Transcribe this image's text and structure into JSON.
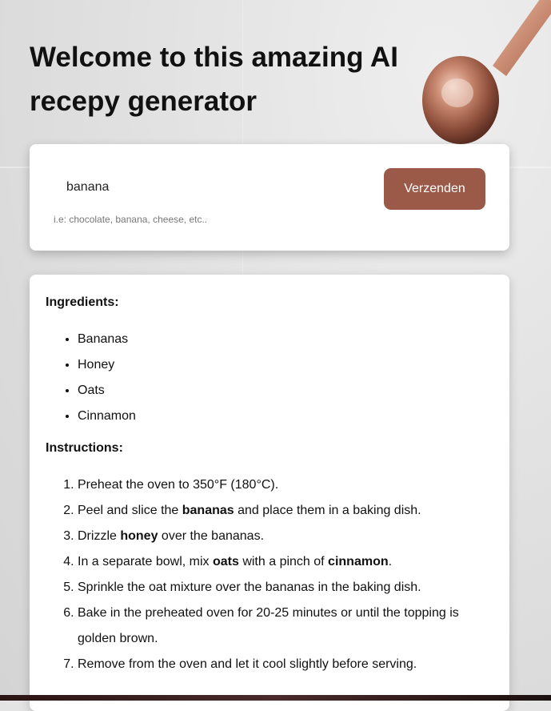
{
  "page": {
    "title": "Welcome to this amazing AI recepy generator"
  },
  "search": {
    "value": "banana",
    "hint": "i.e: chocolate, banana, cheese, etc..",
    "submit_label": "Verzenden"
  },
  "recipe": {
    "ingredients_title": "Ingredients:",
    "ingredients": [
      "Bananas",
      "Honey",
      "Oats",
      "Cinnamon"
    ],
    "instructions_title": "Instructions:",
    "steps": [
      [
        {
          "t": "Preheat the oven to 350°F (180°C).",
          "b": false
        }
      ],
      [
        {
          "t": "Peel and slice the ",
          "b": false
        },
        {
          "t": "bananas",
          "b": true
        },
        {
          "t": " and place them in a baking dish.",
          "b": false
        }
      ],
      [
        {
          "t": "Drizzle ",
          "b": false
        },
        {
          "t": "honey",
          "b": true
        },
        {
          "t": " over the bananas.",
          "b": false
        }
      ],
      [
        {
          "t": "In a separate bowl, mix ",
          "b": false
        },
        {
          "t": "oats",
          "b": true
        },
        {
          "t": " with a pinch of ",
          "b": false
        },
        {
          "t": "cinnamon",
          "b": true
        },
        {
          "t": ".",
          "b": false
        }
      ],
      [
        {
          "t": "Sprinkle the oat mixture over the bananas in the baking dish.",
          "b": false
        }
      ],
      [
        {
          "t": "Bake in the preheated oven for 20-25 minutes or until the topping is golden brown.",
          "b": false
        }
      ],
      [
        {
          "t": "Remove from the oven and let it cool slightly before serving.",
          "b": false
        }
      ]
    ]
  },
  "colors": {
    "accent": "#9a5a47",
    "card": "#ffffff"
  },
  "icons": {
    "decor": "measuring-spoon-icon"
  }
}
